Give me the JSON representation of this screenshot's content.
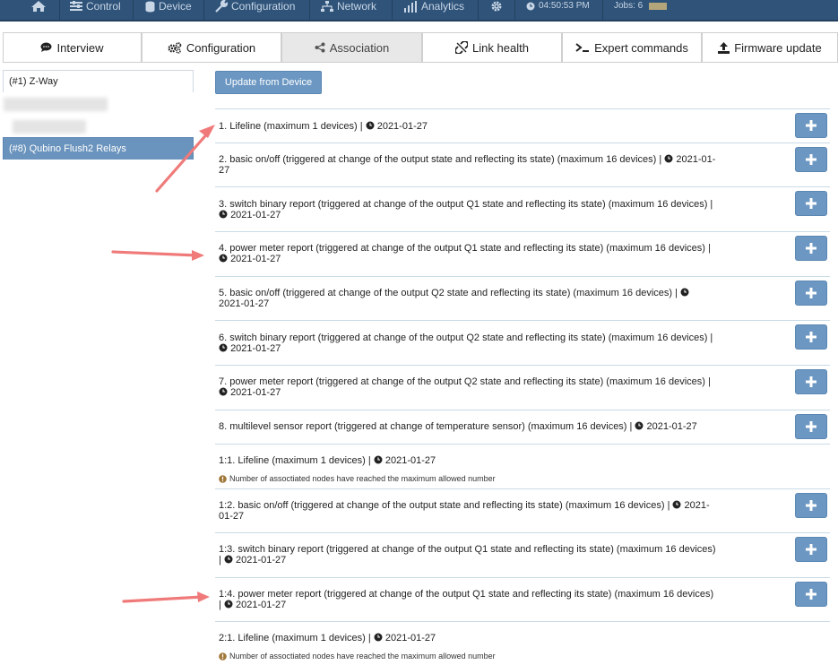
{
  "navbar": {
    "items": [
      {
        "icon": "home-icon",
        "label": ""
      },
      {
        "icon": "sliders-icon",
        "label": "Control"
      },
      {
        "icon": "database-icon",
        "label": "Device"
      },
      {
        "icon": "wrench-icon",
        "label": "Configuration"
      },
      {
        "icon": "network-icon",
        "label": "Network"
      },
      {
        "icon": "bar-chart-icon",
        "label": "Analytics"
      },
      {
        "icon": "gear-icon",
        "label": ""
      }
    ],
    "time": "04:50:53 PM",
    "jobs": "Jobs: 6"
  },
  "tabs": [
    {
      "icon": "comment-icon",
      "label": "Interview"
    },
    {
      "icon": "cogs-icon",
      "label": "Configuration"
    },
    {
      "icon": "share-icon",
      "label": "Association",
      "active": true
    },
    {
      "icon": "unlink-icon",
      "label": "Link health"
    },
    {
      "icon": "terminal-icon",
      "label": "Expert commands"
    },
    {
      "icon": "upload-icon",
      "label": "Firmware update"
    }
  ],
  "devices": {
    "items": [
      {
        "label": "(#1) Z-Way"
      },
      {
        "label": "",
        "obscured": true
      },
      {
        "label": "",
        "obscured": true
      },
      {
        "label": "(#8) Qubino Flush2 Relays",
        "active": true
      }
    ]
  },
  "update_button": "Update from Device",
  "groups": [
    {
      "text": "1. Lifeline (maximum 1 devices) | ",
      "date": "2021-01-27",
      "has_add": true
    },
    {
      "text": "2. basic on/off (triggered at change of the output state and reflecting its state) (maximum 16 devices) | ",
      "date": "2021-01-27",
      "has_add": true
    },
    {
      "text": "3. switch binary report (triggered at change of the output Q1 state and reflecting its state) (maximum 16 devices) | ",
      "date": "2021-01-27",
      "has_add": true
    },
    {
      "text": "4. power meter report (triggered at change of the output Q1 state and reflecting its state) (maximum 16 devices) | ",
      "date": "2021-01-27",
      "has_add": true
    },
    {
      "text": "5. basic on/off (triggered at change of the output Q2 state and reflecting its state) (maximum 16 devices) | ",
      "date": "2021-01-27",
      "has_add": true
    },
    {
      "text": "6. switch binary report (triggered at change of the output Q2 state and reflecting its state) (maximum 16 devices) | ",
      "date": "2021-01-27",
      "has_add": true
    },
    {
      "text": "7. power meter report (triggered at change of the output Q2 state and reflecting its state) (maximum 16 devices) | ",
      "date": "2021-01-27",
      "has_add": true
    },
    {
      "text": "8. multilevel sensor report (triggered at change of temperature sensor) (maximum 16 devices) | ",
      "date": "2021-01-27",
      "has_add": true
    },
    {
      "text": "1:1. Lifeline (maximum 1 devices) | ",
      "date": "2021-01-27",
      "has_add": false,
      "note": "Number of assoctiated nodes have reached the maximum allowed number"
    },
    {
      "text": "1:2. basic on/off (triggered at change of the output state and reflecting its state) (maximum 16 devices) | ",
      "date": "2021-01-27",
      "has_add": true
    },
    {
      "text": "1:3. switch binary report (triggered at change of the output Q1 state and reflecting its state) (maximum 16 devices) | ",
      "date": "2021-01-27",
      "has_add": true
    },
    {
      "text": "1:4. power meter report (triggered at change of the output Q1 state and reflecting its state) (maximum 16 devices) | ",
      "date": "2021-01-27",
      "has_add": true
    },
    {
      "text": "2:1. Lifeline (maximum 1 devices) | ",
      "date": "2021-01-27",
      "has_add": false,
      "note": "Number of assoctiated nodes have reached the maximum allowed number"
    }
  ],
  "colors": {
    "navbar": "#2f5379",
    "accent_button": "#6b97c2",
    "active_device": "#6a93bd",
    "annotation_arrow": "#f07a7a"
  }
}
